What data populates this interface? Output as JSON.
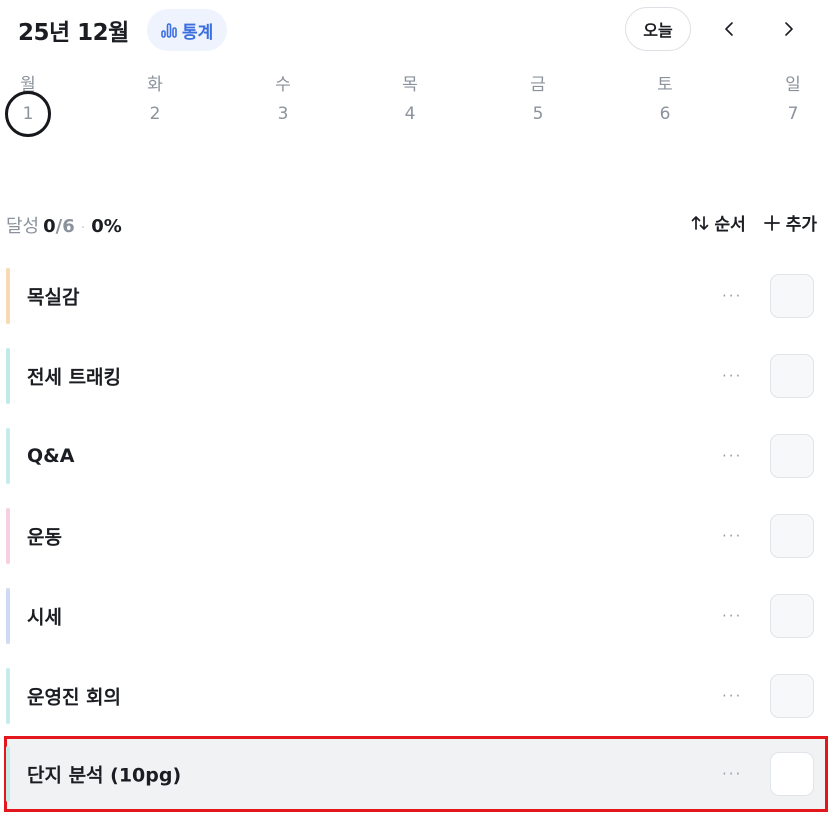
{
  "header": {
    "month_title": "25년 12월",
    "stats_label": "통계",
    "today_label": "오늘",
    "prev_icon": "chevron-left-icon",
    "next_icon": "chevron-right-icon"
  },
  "week": {
    "days": [
      {
        "dow": "월",
        "num": "1",
        "selected": true
      },
      {
        "dow": "화",
        "num": "2",
        "selected": false
      },
      {
        "dow": "수",
        "num": "3",
        "selected": false
      },
      {
        "dow": "목",
        "num": "4",
        "selected": false
      },
      {
        "dow": "금",
        "num": "5",
        "selected": false
      },
      {
        "dow": "토",
        "num": "6",
        "selected": false
      },
      {
        "dow": "일",
        "num": "7",
        "selected": false
      }
    ]
  },
  "summary": {
    "label": "달성",
    "done": "0",
    "total": "/6",
    "separator": "·",
    "percent": "0%"
  },
  "actions": {
    "sort_label": "순서",
    "add_label": "추가"
  },
  "tasks": [
    {
      "name": "목실감",
      "color": "#f8d9b4",
      "more": "···"
    },
    {
      "name": "전세 트래킹",
      "color": "#bfeae6",
      "more": "···"
    },
    {
      "name": "Q&A",
      "color": "#c5ece8",
      "more": "···"
    },
    {
      "name": "운동",
      "color": "#f7cfe0",
      "more": "···"
    },
    {
      "name": "시세",
      "color": "#cfdaf6",
      "more": "···"
    },
    {
      "name": "운영진 회의",
      "color": "#c5ece8",
      "more": "···"
    },
    {
      "name": "단지 분석 (10pg)",
      "color": "#c5ece8",
      "more": "···",
      "highlight": true
    }
  ]
}
